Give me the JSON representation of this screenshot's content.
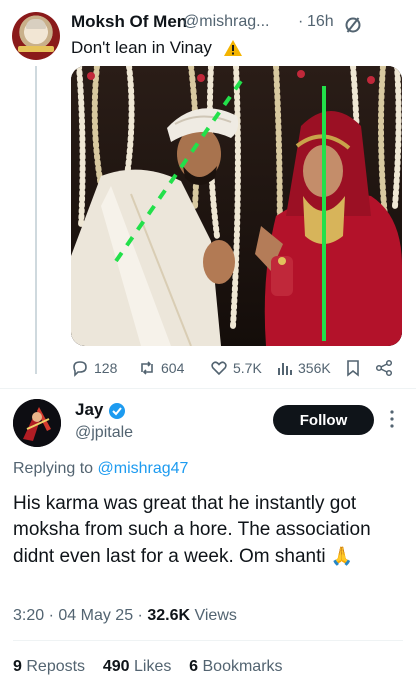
{
  "parent_tweet": {
    "author_name": "Moksh Of Men",
    "author_handle": "@mishrag...",
    "separator": "·",
    "time": "16h",
    "text": "Don't lean in Vinay",
    "icons": {
      "grok": "slashed-circle-icon",
      "emoji": "warning-icon"
    },
    "photo_description": "wedding-couple-photo",
    "actions": {
      "replies": "128",
      "reposts": "604",
      "likes": "5.7K",
      "views": "356K"
    }
  },
  "reply_tweet": {
    "author_name": "Jay",
    "author_handle": "@jpitale",
    "follow_label": "Follow",
    "replying_prefix": "Replying to",
    "replying_to": "@mishrag47",
    "text": "His karma was great that he instantly got moksha from such a hore. The association didnt even last for a week. Om shanti",
    "emoji": "🙏",
    "time": "3:20",
    "dot": "·",
    "date": "04 May 25",
    "views_count": "32.6K",
    "views_label": "Views",
    "reposts_count": "9",
    "reposts_label": "Reposts",
    "likes_count": "490",
    "likes_label": "Likes",
    "bookmarks_count": "6",
    "bookmarks_label": "Bookmarks"
  },
  "colors": {
    "link": "#1d9bf0",
    "muted": "#536471",
    "text": "#0f1419",
    "guide_line": "#22e04a"
  }
}
